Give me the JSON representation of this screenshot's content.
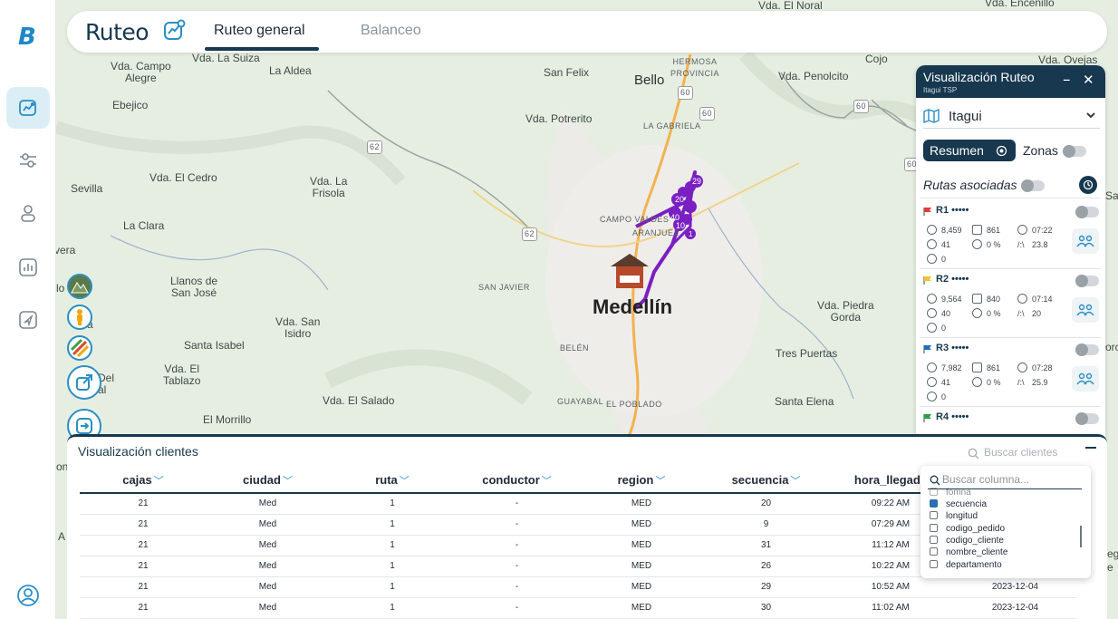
{
  "rail": {
    "logo": "B"
  },
  "header": {
    "brand": "Ruteo",
    "tabs": [
      {
        "label": "Ruteo general",
        "active": true
      },
      {
        "label": "Balanceo",
        "active": false
      }
    ]
  },
  "map": {
    "places": [
      "Vda. El Noral",
      "Vda. Encenillo",
      "Vda. La Suiza",
      "Vda. Campo\nAlegre",
      "La Aldea",
      "San Felix",
      "HERMOSA\nPROVINCIA",
      "Bello",
      "Vda. Penolcito",
      "Cojo",
      "Vda. Ovejas",
      "Ebejico",
      "Vda. Potrerito",
      "LA GABRIELA",
      "Vda. El Cedro",
      "Vda. La\nFrisola",
      "Sevilla",
      "La Clara",
      "CAMPO VALDES",
      "ARANJUEZ",
      "vera",
      "SAN JAVIER",
      "Medellín",
      "Llanos de\nSan José",
      "Vda. San\nIsidro",
      "Vda. Piedra\nGorda",
      "Santa Isabel",
      "BELÉN",
      "Tres Puertas",
      "Vda. El\nTablazo",
      "Vda. El Salado",
      "GUAYABAL",
      "EL POBLADO",
      "Santa Elena",
      "El Morrillo",
      "lo",
      "iana",
      "Del",
      "al",
      "Sa",
      "orc",
      "on",
      "A",
      "eg",
      "e"
    ],
    "road_shields": [
      "62",
      "62",
      "60",
      "60",
      "60",
      "60"
    ],
    "markers": [
      "29",
      "2",
      "2",
      "3",
      "5",
      "20",
      "40",
      "10",
      "1"
    ]
  },
  "panel": {
    "title": "Visualización Ruteo",
    "subtitle": "Itagui TSP",
    "minimize": "–",
    "close": "✕",
    "city": "Itagui",
    "resumen_label": "Resumen",
    "zonas_label": "Zonas",
    "rutas_label": "Rutas asociadas",
    "routes": [
      {
        "name": "R1 •••••",
        "flag_color": "#e53935",
        "kg": "8,459",
        "boxes": "861",
        "time": "07:22",
        "stops": "41",
        "pct": "0 %",
        "km": "23.8",
        "cost": "0"
      },
      {
        "name": "R2 •••••",
        "flag_color": "#f2c230",
        "kg": "9,564",
        "boxes": "840",
        "time": "07:14",
        "stops": "40",
        "pct": "0 %",
        "km": "20",
        "cost": "0"
      },
      {
        "name": "R3 •••••",
        "flag_color": "#1e6fbf",
        "kg": "7,982",
        "boxes": "861",
        "time": "07:28",
        "stops": "41",
        "pct": "0 %",
        "km": "25.9",
        "cost": "0"
      },
      {
        "name": "R4 •••••",
        "flag_color": "#2e9e44"
      }
    ]
  },
  "clients": {
    "title": "Visualización clientes",
    "search_placeholder": "Buscar clientes",
    "columns": [
      "cajas",
      "ciudad",
      "ruta",
      "conductor",
      "region",
      "secuencia",
      "hora_llegada"
    ],
    "rows": [
      [
        "21",
        "Med",
        "1",
        "-",
        "MED",
        "20",
        "09:22 AM",
        ""
      ],
      [
        "21",
        "Med",
        "1",
        "-",
        "MED",
        "9",
        "07:29 AM",
        ""
      ],
      [
        "21",
        "Med",
        "1",
        "-",
        "MED",
        "31",
        "11:12 AM",
        ""
      ],
      [
        "21",
        "Med",
        "1",
        "-",
        "MED",
        "26",
        "10:22 AM",
        ""
      ],
      [
        "21",
        "Med",
        "1",
        "-",
        "MED",
        "29",
        "10:52 AM",
        "2023-12-04"
      ],
      [
        "21",
        "Med",
        "1",
        "-",
        "MED",
        "30",
        "11:02 AM",
        "2023-12-04"
      ]
    ]
  },
  "column_picker": {
    "placeholder": "Buscar columna...",
    "options": [
      {
        "label": "fomna",
        "checked": false
      },
      {
        "label": "secuencia",
        "checked": true
      },
      {
        "label": "longitud",
        "checked": false
      },
      {
        "label": "codigo_pedido",
        "checked": false
      },
      {
        "label": "codigo_cliente",
        "checked": false
      },
      {
        "label": "nombre_cliente",
        "checked": false
      },
      {
        "label": "departamento",
        "checked": false
      }
    ]
  },
  "colors": {
    "primary": "#17384e",
    "accent": "#2a8fc4",
    "route": "#7a1fc2"
  }
}
